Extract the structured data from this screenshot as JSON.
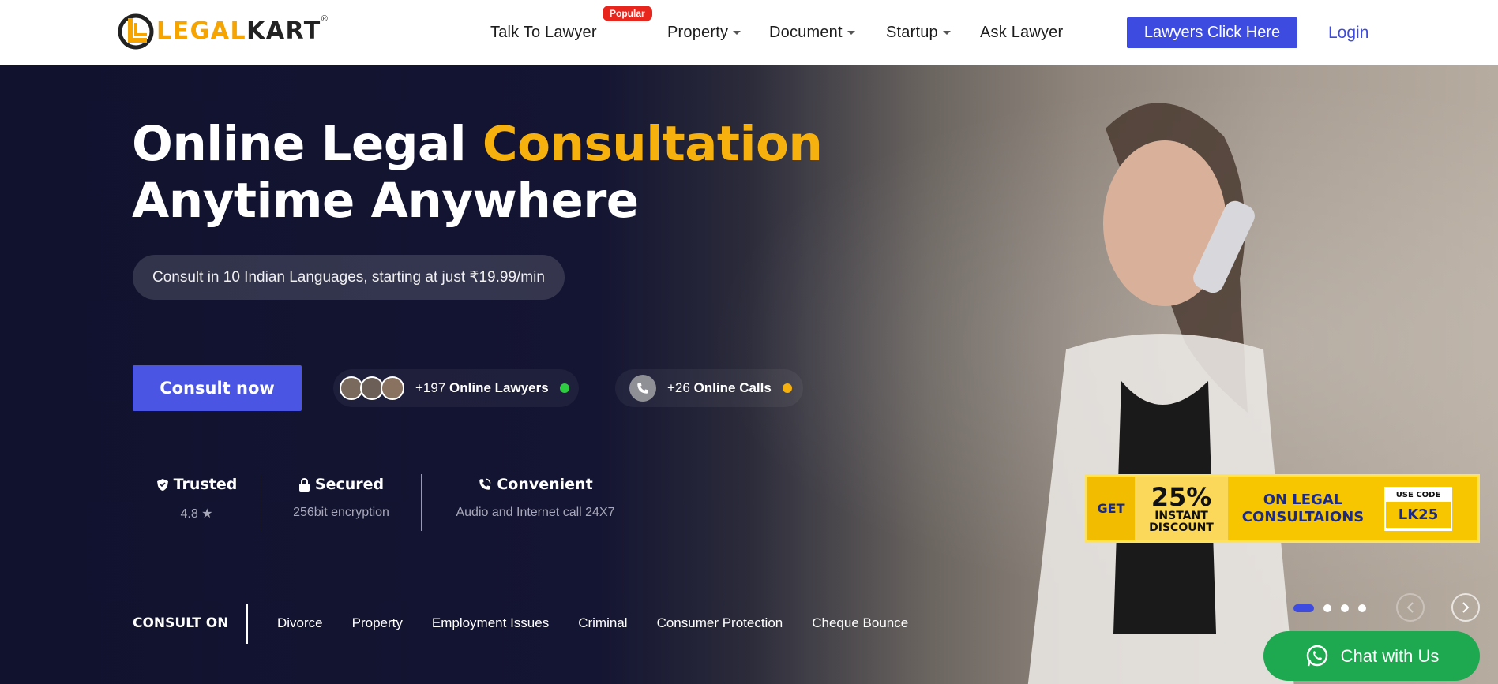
{
  "brand": {
    "logo_part1": "LEGAL",
    "logo_part2": "KART",
    "registered": "®"
  },
  "nav": {
    "items": [
      {
        "label": "Talk To Lawyer"
      },
      {
        "label": "Property"
      },
      {
        "label": "Document"
      },
      {
        "label": "Startup"
      },
      {
        "label": "Ask Lawyer"
      }
    ],
    "badge": "Popular",
    "lawyers_button": "Lawyers Click Here",
    "login": "Login"
  },
  "hero": {
    "title_line1_plain": "Online Legal ",
    "title_line1_highlight": "Consultation",
    "title_line2": "Anytime Anywhere",
    "subtitle": "Consult in 10 Indian Languages, starting at just ₹19.99/min",
    "cta": "Consult now",
    "lawyers_count": "+197",
    "lawyers_label": "Online Lawyers",
    "calls_count": "+26",
    "calls_label": "Online Calls"
  },
  "trust": [
    {
      "title": "Trusted",
      "sub": "4.8 ★"
    },
    {
      "title": "Secured",
      "sub": "256bit encryption"
    },
    {
      "title": "Convenient",
      "sub": "Audio and Internet call 24X7"
    }
  ],
  "consult_on": {
    "label": "CONSULT ON",
    "tags": [
      "Divorce",
      "Property",
      "Employment Issues",
      "Criminal",
      "Consumer Protection",
      "Cheque Bounce"
    ]
  },
  "promo": {
    "get": "GET",
    "percent": "25%",
    "instant": "INSTANT",
    "discount": "DISCOUNT",
    "on_line1": "ON LEGAL",
    "on_line2": "CONSULTAIONS",
    "code_label": "USE CODE",
    "code": "LK25"
  },
  "chat": {
    "label": "Chat with Us"
  },
  "colors": {
    "accent": "#3d4be0",
    "highlight": "#f6b10e",
    "whatsapp": "#1ea84f",
    "online_green": "#2ecc40",
    "calls_yellow": "#f6b10e"
  }
}
